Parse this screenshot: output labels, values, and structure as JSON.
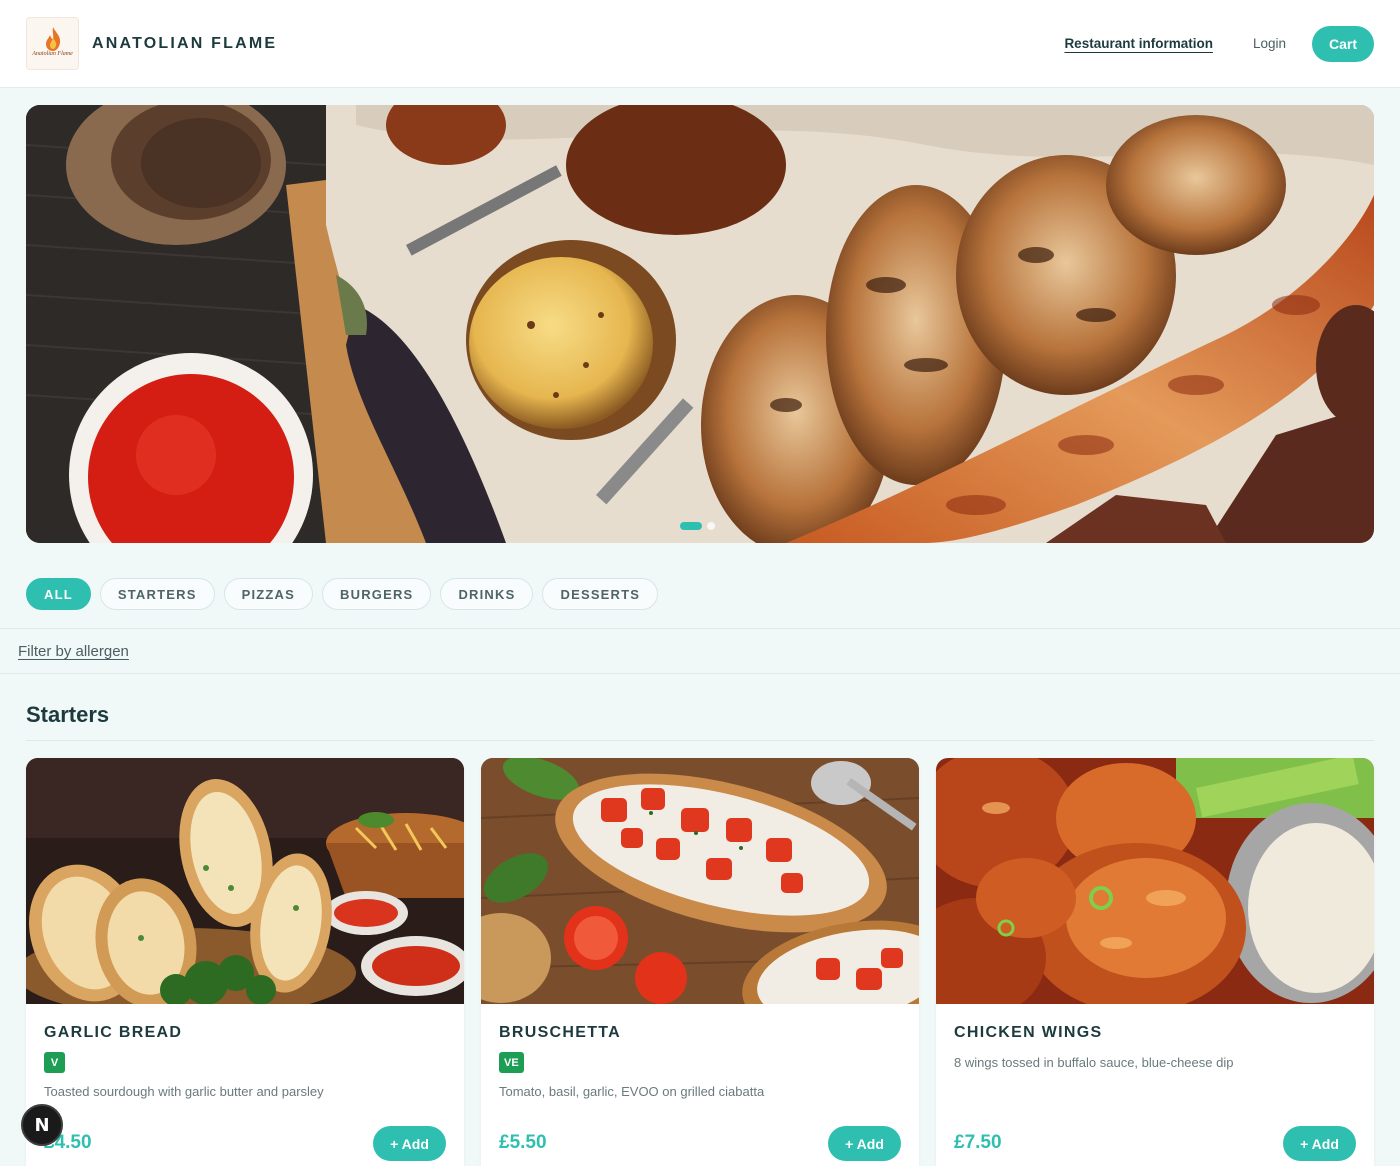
{
  "header": {
    "logo_text": "Anatolian Flame",
    "brand": "ANATOLIAN FLAME",
    "nav": {
      "info": "Restaurant information",
      "login": "Login",
      "cart": "Cart"
    }
  },
  "hero": {
    "slide_count": 2,
    "active_slide": 1
  },
  "categories": [
    "ALL",
    "STARTERS",
    "PIZZAS",
    "BURGERS",
    "DRINKS",
    "DESSERTS"
  ],
  "active_category": "ALL",
  "filter": {
    "label": "Filter by allergen"
  },
  "section": {
    "title": "Starters"
  },
  "items": [
    {
      "name": "GARLIC BREAD",
      "badge": "V",
      "description": "Toasted sourdough with garlic butter and parsley",
      "price": "£4.50",
      "add_label": "+ Add"
    },
    {
      "name": "BRUSCHETTA",
      "badge": "VE",
      "description": "Tomato, basil, garlic, EVOO on grilled ciabatta",
      "price": "£5.50",
      "add_label": "+ Add"
    },
    {
      "name": "CHICKEN WINGS",
      "badge": "",
      "description": "8 wings tossed in buffalo sauce, blue-cheese dip",
      "price": "£7.50",
      "add_label": "+ Add"
    }
  ],
  "dev_badge": {
    "letter": "N"
  },
  "colors": {
    "accent": "#2fbfb0",
    "brand_text": "#1d3b3e",
    "veg_badge": "#1e9e55",
    "page_bg": "#f1f8f8"
  }
}
